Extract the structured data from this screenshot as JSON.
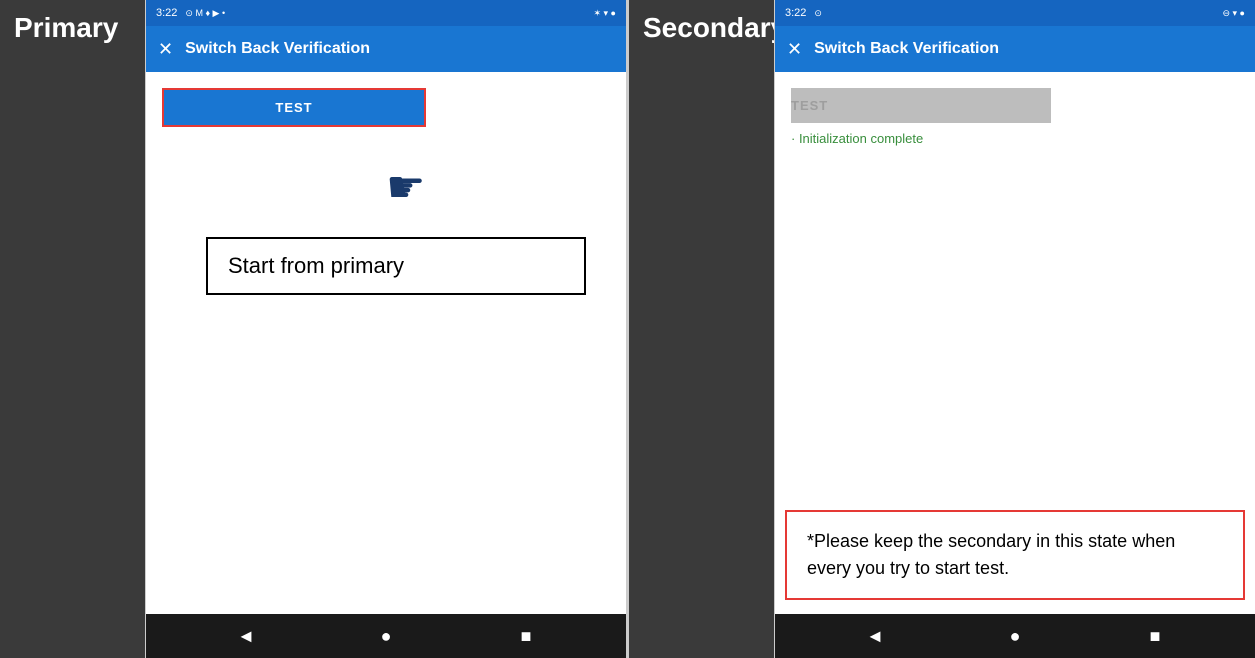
{
  "primary": {
    "panel_label": "Primary",
    "status_bar": {
      "time": "3:22",
      "left_icons": "◎ M ♦ ▶ •",
      "right_icons": "✶ ▼ ●"
    },
    "app_bar": {
      "close_icon": "✕",
      "title": "Switch Back Verification"
    },
    "test_button_label": "TEST",
    "callout_text": "Start from primary",
    "nav_back": "◄",
    "nav_home": "●",
    "nav_recent": "■"
  },
  "secondary": {
    "panel_label": "Secondary",
    "status_bar": {
      "time": "3:22",
      "left_icons": "◎",
      "right_icons": "⊖ ▼ ●"
    },
    "app_bar": {
      "close_icon": "✕",
      "title": "Switch Back Verification"
    },
    "test_button_label": "TEST",
    "init_message": "· Initialization complete",
    "note_text": "*Please keep the secondary in this state when every you try to start test.",
    "nav_back": "◄",
    "nav_home": "●",
    "nav_recent": "■"
  }
}
